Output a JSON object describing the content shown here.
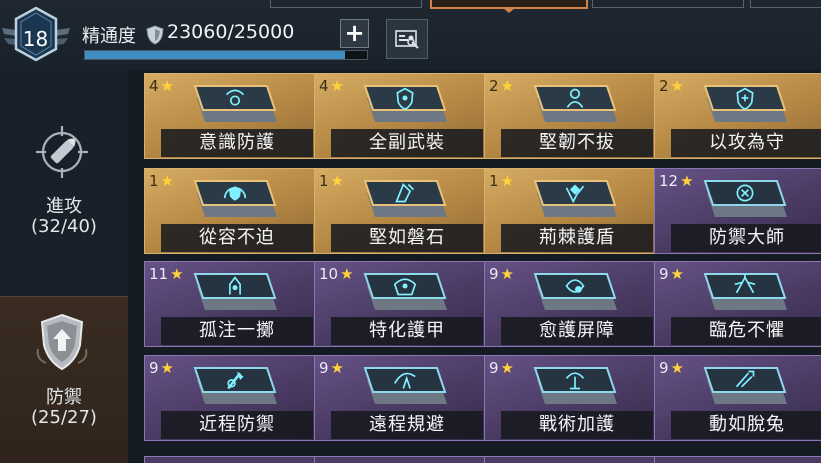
{
  "header": {
    "level": "18",
    "mastery_label": "精通度",
    "mastery_value": "23060/25000",
    "mastery_progress": 0.9224,
    "plus_icon": "plus-icon",
    "info_icon": "profile-card-icon"
  },
  "sidebar": {
    "attack": {
      "name": "進攻",
      "count": "(32/40)",
      "icon": "crosshair-bullet-icon"
    },
    "defense": {
      "name": "防禦",
      "count": "(25/27)",
      "icon": "shield-arrow-icon",
      "active": true
    }
  },
  "skills": [
    {
      "name": "意識防護",
      "level": "4",
      "rarity": "gold"
    },
    {
      "name": "全副武裝",
      "level": "4",
      "rarity": "gold"
    },
    {
      "name": "堅韌不拔",
      "level": "2",
      "rarity": "gold"
    },
    {
      "name": "以攻為守",
      "level": "2",
      "rarity": "gold"
    },
    {
      "name": "從容不迫",
      "level": "1",
      "rarity": "gold"
    },
    {
      "name": "堅如磐石",
      "level": "1",
      "rarity": "gold"
    },
    {
      "name": "荊棘護盾",
      "level": "1",
      "rarity": "gold"
    },
    {
      "name": "防禦大師",
      "level": "12",
      "rarity": "purple"
    },
    {
      "name": "孤注一擲",
      "level": "11",
      "rarity": "purple"
    },
    {
      "name": "特化護甲",
      "level": "10",
      "rarity": "purple"
    },
    {
      "name": "愈護屏障",
      "level": "9",
      "rarity": "purple"
    },
    {
      "name": "臨危不懼",
      "level": "9",
      "rarity": "purple"
    },
    {
      "name": "近程防禦",
      "level": "9",
      "rarity": "purple"
    },
    {
      "name": "遠程規避",
      "level": "9",
      "rarity": "purple"
    },
    {
      "name": "戰術加護",
      "level": "9",
      "rarity": "purple"
    },
    {
      "name": "動如脫兔",
      "level": "9",
      "rarity": "purple"
    }
  ],
  "star_glyph": "★",
  "colors": {
    "gold_card": "#c49a55",
    "purple_card": "#4f3f6b",
    "accent_blue": "#3e8cc0",
    "star": "#ffd23c"
  }
}
